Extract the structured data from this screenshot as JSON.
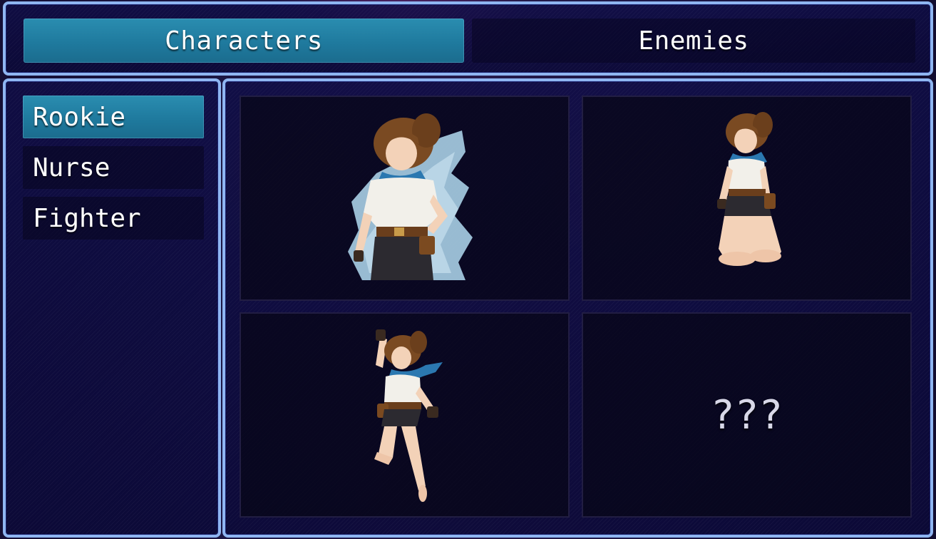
{
  "tabs": [
    {
      "label": "Characters",
      "active": true
    },
    {
      "label": "Enemies",
      "active": false
    }
  ],
  "character_list": [
    {
      "label": "Rookie",
      "selected": true
    },
    {
      "label": "Nurse",
      "selected": false
    },
    {
      "label": "Fighter",
      "selected": false
    }
  ],
  "gallery": {
    "cells": [
      {
        "type": "image",
        "image": "rookie-portrait-standing"
      },
      {
        "type": "image",
        "image": "rookie-kneeling"
      },
      {
        "type": "image",
        "image": "rookie-jumping"
      },
      {
        "type": "locked",
        "label": "???"
      }
    ]
  },
  "colors": {
    "window_border": "#8fb6f2",
    "highlight": "#1f7a9e",
    "window_bg": "#0e0c46"
  }
}
